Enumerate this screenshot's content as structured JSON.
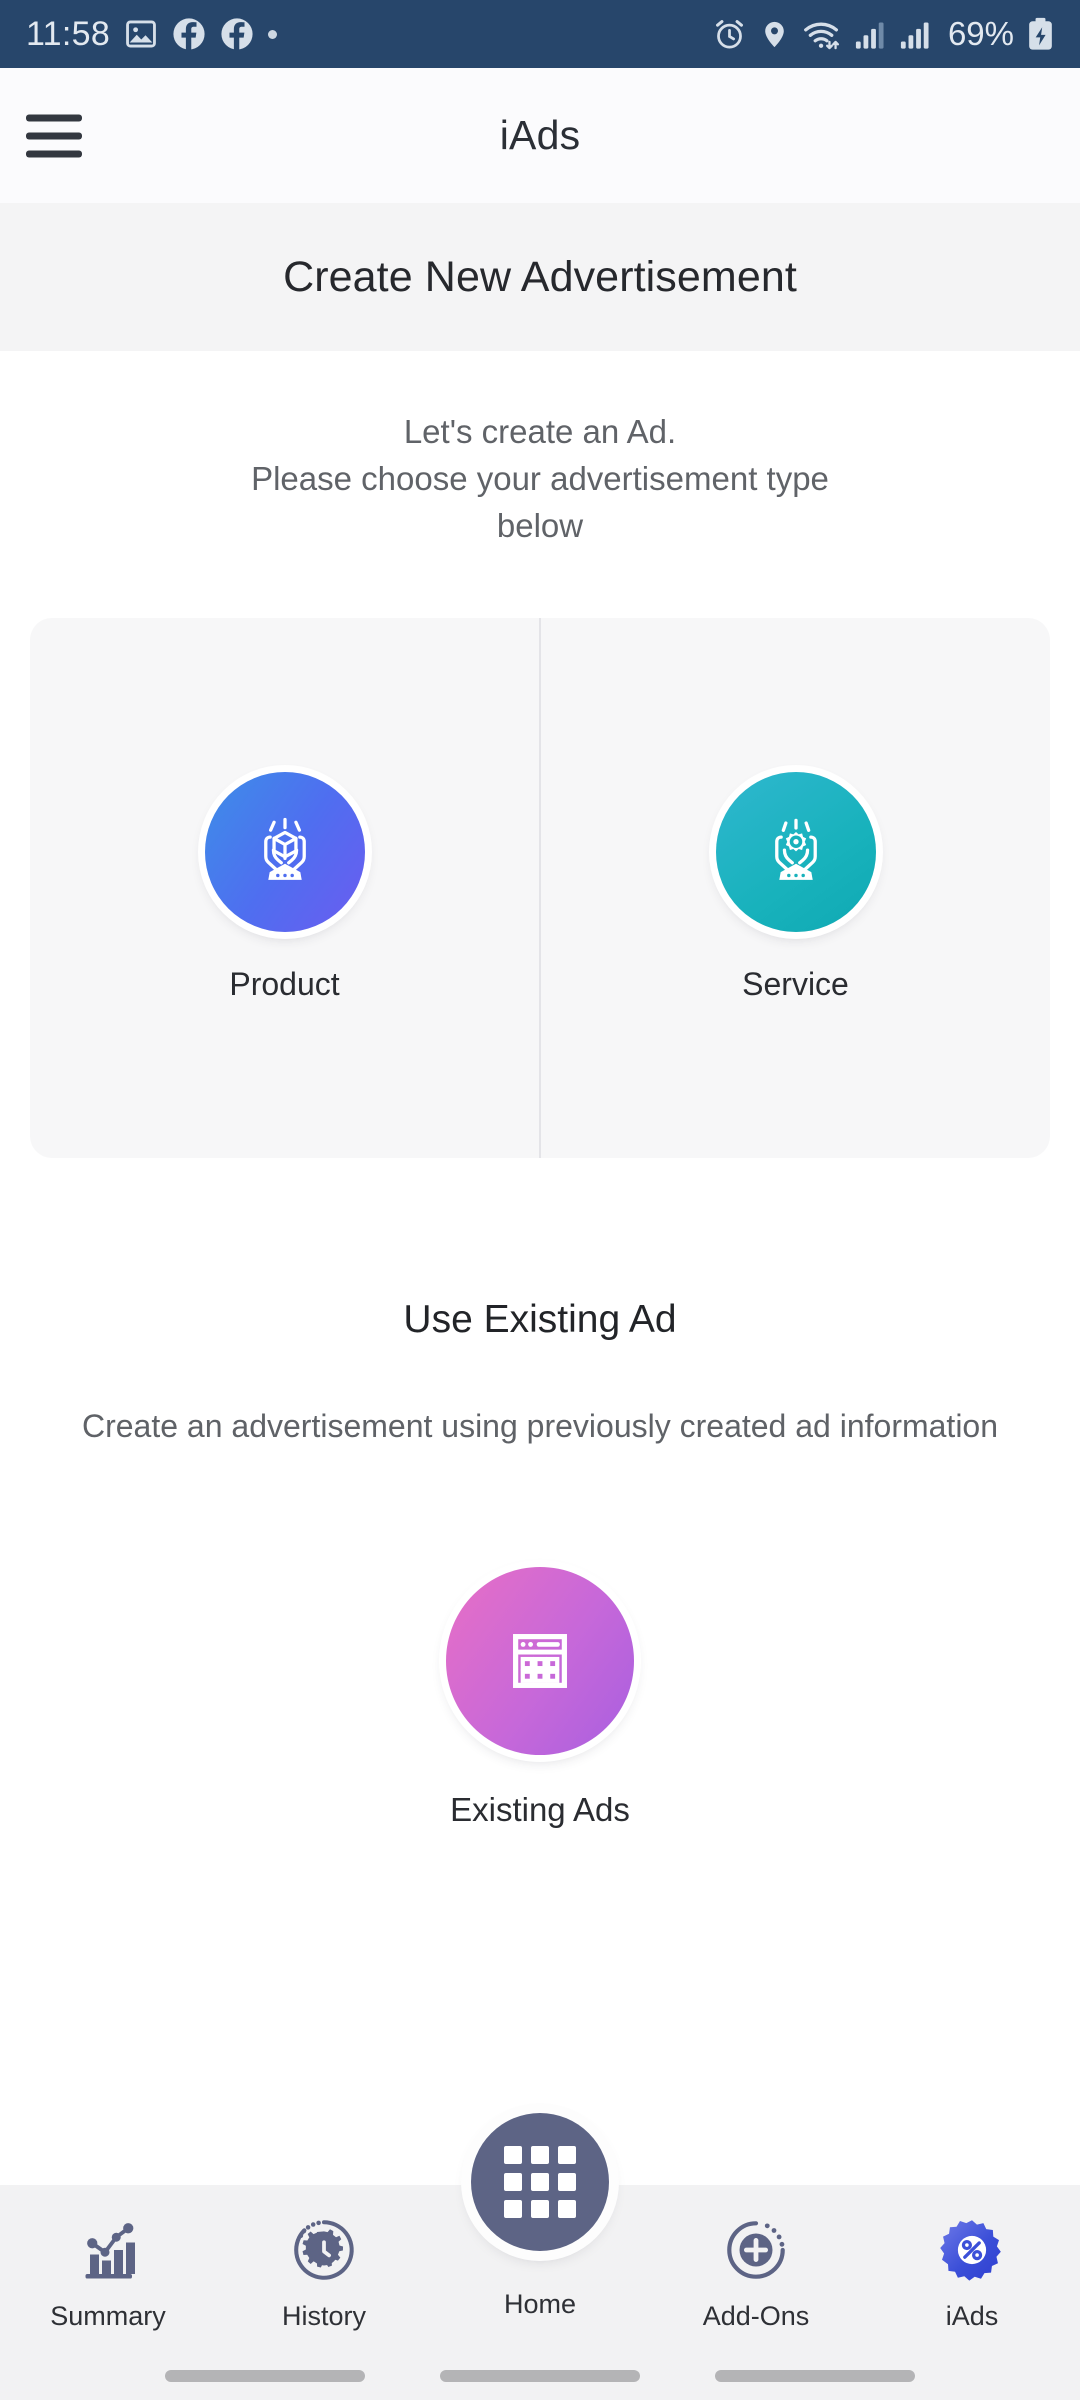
{
  "status_bar": {
    "time": "11:58",
    "battery_percent": "69%",
    "left_icons": [
      "image-icon",
      "facebook-icon",
      "facebook-icon",
      "dot-icon"
    ],
    "right_icons": [
      "alarm-icon",
      "location-icon",
      "wifi-icon",
      "signal-icon",
      "signal-icon",
      "battery-charging-icon"
    ],
    "background_color": "#27466B"
  },
  "app_bar": {
    "menu_icon": "hamburger-menu-icon",
    "title": "iAds"
  },
  "section_header": {
    "title": "Create New Advertisement"
  },
  "main": {
    "lead_line1": "Let's create an Ad.",
    "lead_line2": "Please choose your advertisement type",
    "lead_line3": "below",
    "choices": [
      {
        "label": "Product",
        "icon": "hands-holding-cube-icon",
        "color": "#4f6ef0"
      },
      {
        "label": "Service",
        "icon": "hands-holding-gear-icon",
        "color": "#18b2bc"
      }
    ],
    "existing": {
      "title": "Use Existing Ad",
      "description_line1": "Create an advertisement using previously created ad",
      "description_line2": "information",
      "label": "Existing Ads",
      "icon": "window-grid-icon",
      "color": "#c768d9"
    }
  },
  "bottom_nav": {
    "items": [
      {
        "label": "Summary",
        "icon": "bar-chart-trend-icon"
      },
      {
        "label": "History",
        "icon": "gear-clock-icon"
      },
      {
        "label": "Home",
        "icon": "grid-apps-icon"
      },
      {
        "label": "Add-Ons",
        "icon": "plus-circle-icon"
      },
      {
        "label": "iAds",
        "icon": "percent-badge-icon"
      }
    ],
    "active": "Home",
    "accent_color": "#5d6485",
    "iads_color": "#3b4fd8"
  }
}
